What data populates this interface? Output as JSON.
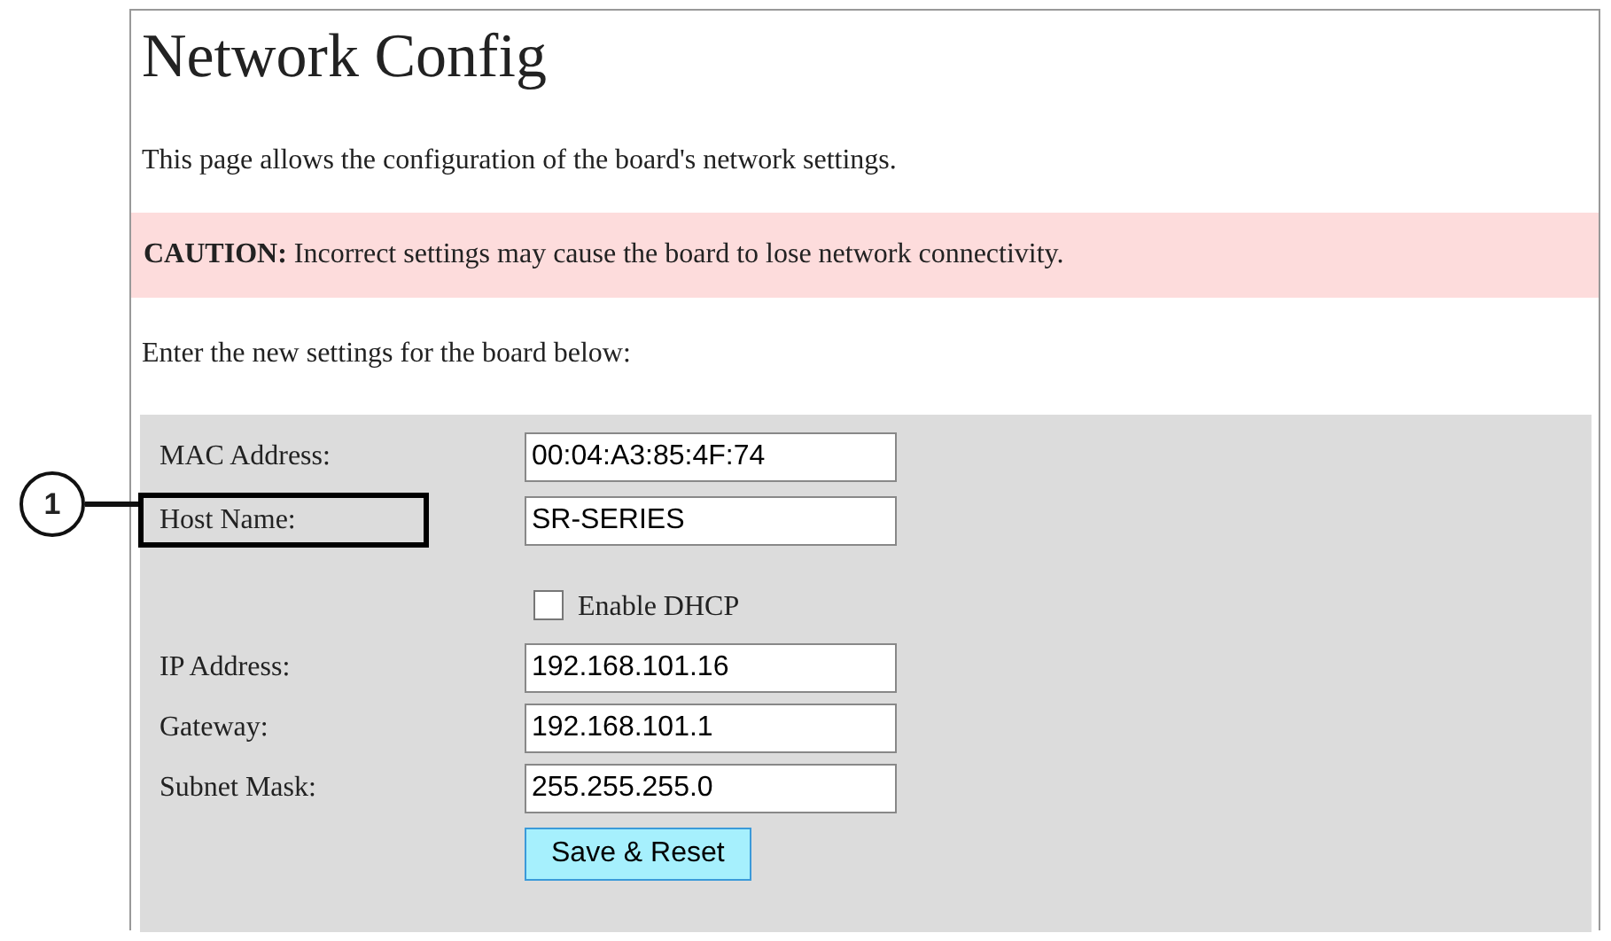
{
  "title": "Network Config",
  "intro": "This page allows the configuration of the board's network settings.",
  "caution": "**CAUTION:** Incorrect settings may cause the board to lose network connectivity.",
  "prompt": "Enter the new settings for the board below:",
  "form": {
    "rows": [
      {
        "kind": "field",
        "label": "MAC Address:",
        "value": "00:04:A3:85:4F:74",
        "highlighted": false
      },
      {
        "kind": "field",
        "label": "Host Name:",
        "value": "SR-SERIES",
        "highlighted": true
      },
      {
        "kind": "checkbox",
        "label": "Enable DHCP",
        "checked": false
      },
      {
        "kind": "field",
        "label": "IP Address:",
        "value": "192.168.101.16",
        "highlighted": false
      },
      {
        "kind": "field",
        "label": "Gateway:",
        "value": "192.168.101.1",
        "highlighted": false
      },
      {
        "kind": "field",
        "label": "Subnet Mask:",
        "value": "255.255.255.0",
        "highlighted": false
      }
    ],
    "button": "Save & Reset"
  },
  "callout": {
    "number": "1"
  }
}
